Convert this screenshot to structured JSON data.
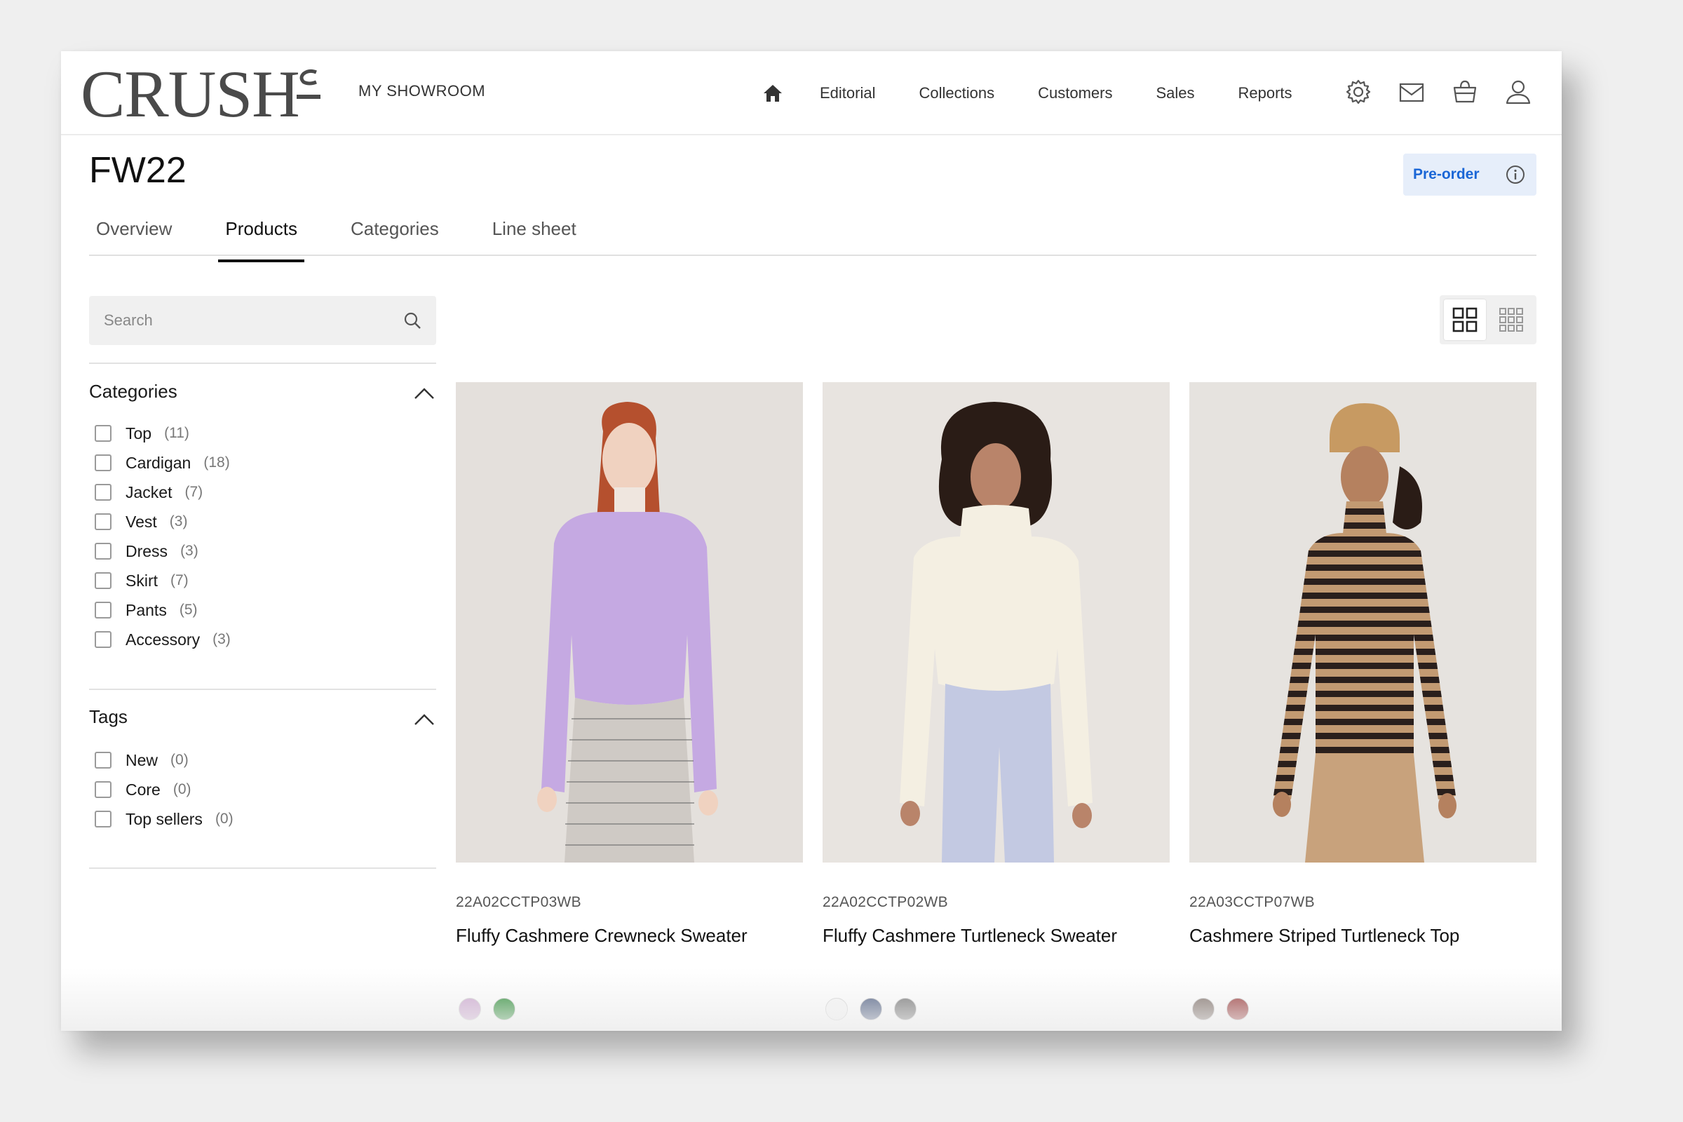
{
  "header": {
    "logo": "CRUSH",
    "showroom_label": "MY SHOWROOM",
    "nav": [
      "Editorial",
      "Collections",
      "Customers",
      "Sales",
      "Reports"
    ],
    "icons": [
      "home-icon",
      "settings-icon",
      "mail-icon",
      "bag-icon",
      "user-icon"
    ]
  },
  "page": {
    "title": "FW22",
    "preorder_label": "Pre-order",
    "tabs": [
      "Overview",
      "Products",
      "Categories",
      "Line sheet"
    ],
    "active_tab": "Products"
  },
  "sidebar": {
    "search_placeholder": "Search",
    "categories_title": "Categories",
    "categories": [
      {
        "label": "Top",
        "count": "(11)"
      },
      {
        "label": "Cardigan",
        "count": "(18)"
      },
      {
        "label": "Jacket",
        "count": "(7)"
      },
      {
        "label": "Vest",
        "count": "(3)"
      },
      {
        "label": "Dress",
        "count": "(3)"
      },
      {
        "label": "Skirt",
        "count": "(7)"
      },
      {
        "label": "Pants",
        "count": "(5)"
      },
      {
        "label": "Accessory",
        "count": "(3)"
      }
    ],
    "tags_title": "Tags",
    "tags": [
      {
        "label": "New",
        "count": "(0)"
      },
      {
        "label": "Core",
        "count": "(0)"
      },
      {
        "label": "Top sellers",
        "count": "(0)"
      }
    ]
  },
  "view": {
    "active": "grid-large"
  },
  "products": [
    {
      "sku": "22A02CCTP03WB",
      "name": "Fluffy Cashmere Crewneck Sweater",
      "colors": [
        "#c79ccb",
        "#0f7d1a"
      ]
    },
    {
      "sku": "22A02CCTP02WB",
      "name": "Fluffy Cashmere Turtleneck Sweater",
      "colors": [
        "#f7f7f7",
        "#34466f",
        "#5f5f5f"
      ]
    },
    {
      "sku": "22A03CCTP07WB",
      "name": "Cashmere Striped Turtleneck Top",
      "colors": [
        "#6b5a52",
        "#8a1c1c"
      ]
    }
  ]
}
